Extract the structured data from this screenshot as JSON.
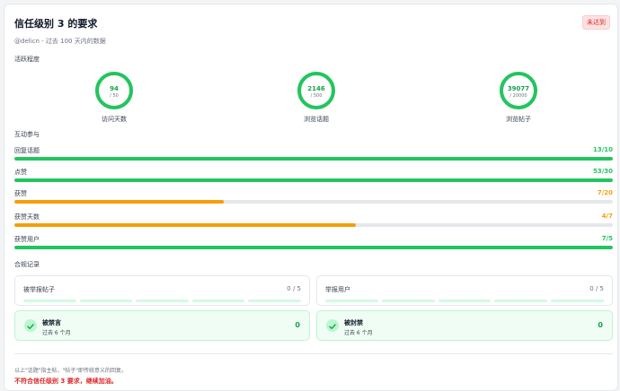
{
  "header": {
    "title": "信任级别 3 的要求",
    "status_badge": "未达到",
    "subtitle": "@delicn - 过去 100 天内的数据"
  },
  "activity": {
    "section_label": "活跃程度",
    "rings": [
      {
        "value": "94",
        "target": "/ 50",
        "label": "访问天数",
        "fraction": 1.0
      },
      {
        "value": "2146",
        "target": "/ 500",
        "label": "浏览话题",
        "fraction": 1.0
      },
      {
        "value": "39077",
        "target": "/ 20000",
        "label": "浏览帖子",
        "fraction": 1.0
      }
    ]
  },
  "engagement": {
    "section_label": "互动参与",
    "bars": [
      {
        "label": "回复话题",
        "value_text": "13/10",
        "fraction": 1.0,
        "color": "#22c55e"
      },
      {
        "label": "点赞",
        "value_text": "53/30",
        "fraction": 1.0,
        "color": "#22c55e"
      },
      {
        "label": "获赞",
        "value_text": "7/20",
        "fraction": 0.35,
        "color": "#f59e0b"
      },
      {
        "label": "获赞天数",
        "value_text": "4/7",
        "fraction": 0.571,
        "color": "#f59e0b"
      },
      {
        "label": "获赞用户",
        "value_text": "7/5",
        "fraction": 1.0,
        "color": "#22c55e"
      }
    ]
  },
  "compliance": {
    "section_label": "合规记录",
    "reported_posts": {
      "label": "被举报帖子",
      "value": "0 / 5"
    },
    "reported_users": {
      "label": "举报用户",
      "value": "0 / 5"
    },
    "silenced": {
      "title": "被禁言",
      "sub": "过去 6 个月",
      "value": "0"
    },
    "suspended": {
      "title": "被封禁",
      "sub": "过去 6 个月",
      "value": "0"
    }
  },
  "footer": {
    "note": "以上\"话题\"指主帖，\"帖子\"即传统意义的回复。",
    "result": "不符合信任级别 3 要求，继续加油。"
  },
  "colors": {
    "success": "#22c55e",
    "warning": "#f59e0b",
    "danger": "#dc2626"
  }
}
